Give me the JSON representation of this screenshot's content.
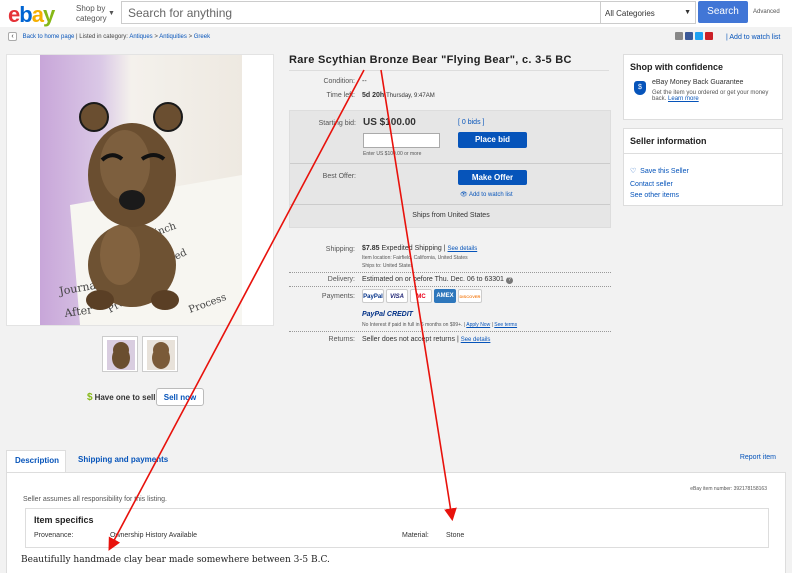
{
  "header": {
    "logo": {
      "e": "e",
      "b": "b",
      "a": "a",
      "y": "y"
    },
    "shop_by_line1": "Shop by",
    "shop_by_line2": "category",
    "search_placeholder": "Search for anything",
    "category": "All Categories",
    "search_label": "Search",
    "advanced_label": "Advanced"
  },
  "breadcrumb": {
    "back_label": "Back to home page",
    "listed_in": "| Listed in category:",
    "items": [
      "Antiques",
      "Antiquities",
      "Greek"
    ],
    "separator": ">"
  },
  "watch_link": "Add to watch list",
  "listing": {
    "title": "Rare Scythian Bronze Bear \"Flying Bear\", c. 3-5 BC",
    "condition_label": "Condition:",
    "condition_value": "--",
    "time_left_label": "Time left:",
    "time_left_value": "5d 20h",
    "time_left_detail": "Thursday, 9:47AM",
    "starting_bid_label": "Starting bid:",
    "starting_bid_value": "US $100.00",
    "bids_label": "[ 0 bids ]",
    "bid_hint": "Enter US $100.00 or more",
    "place_bid_label": "Place bid",
    "best_offer_label": "Best Offer:",
    "make_offer_label": "Make Offer",
    "add_to_watch": "Add to watch list",
    "ships_from": "Ships from United States"
  },
  "shipping": {
    "label": "Shipping:",
    "price": "$7.85",
    "service": "Expedited Shipping",
    "see_details": "See details",
    "location_line": "Item location:  Fairfield, California, United States",
    "ships_to_line": "Ships to:  United States",
    "delivery_label": "Delivery:",
    "delivery_value": "Estimated on or before Thu. Dec. 06 to 63301",
    "payments_label": "Payments:",
    "pay_logos": [
      "PayPal",
      "VISA",
      "MC",
      "AMEX",
      "DISCOVER"
    ],
    "paypal_credit": "PayPal CREDIT",
    "credit_line": "No Interest if paid in full in 6 months on $99+.",
    "apply_now": "Apply Now",
    "see_terms": "See terms",
    "returns_label": "Returns:",
    "returns_value": "Seller does not accept returns",
    "returns_see_details": "See details"
  },
  "sell": {
    "prompt": "Have one to sell?",
    "button": "Sell now"
  },
  "confidence": {
    "title": "Shop with confidence",
    "guarantee_title": "eBay Money Back Guarantee",
    "guarantee_text": "Get the item you ordered or get your money back.",
    "learn_more": "Learn more"
  },
  "seller": {
    "title": "Seller information",
    "save_seller": "Save this Seller",
    "contact": "Contact seller",
    "other_items": "See other items"
  },
  "description": {
    "tab_description": "Description",
    "tab_shipping": "Shipping and payments",
    "report_item": "Report item",
    "item_number": "eBay item number:   392178158163",
    "responsibility": "Seller assumes all responsibility for this listing.",
    "specifics_title": "Item specifics",
    "provenance_label": "Provenance:",
    "provenance_value": "Ownership History Available",
    "material_label": "Material:",
    "material_value": "Stone",
    "body_text": "Beautifully handmade clay bear made somewhere between 3-5 B.C."
  },
  "colors": {
    "accent": "#0654ba",
    "arrow": "#e8120c"
  }
}
